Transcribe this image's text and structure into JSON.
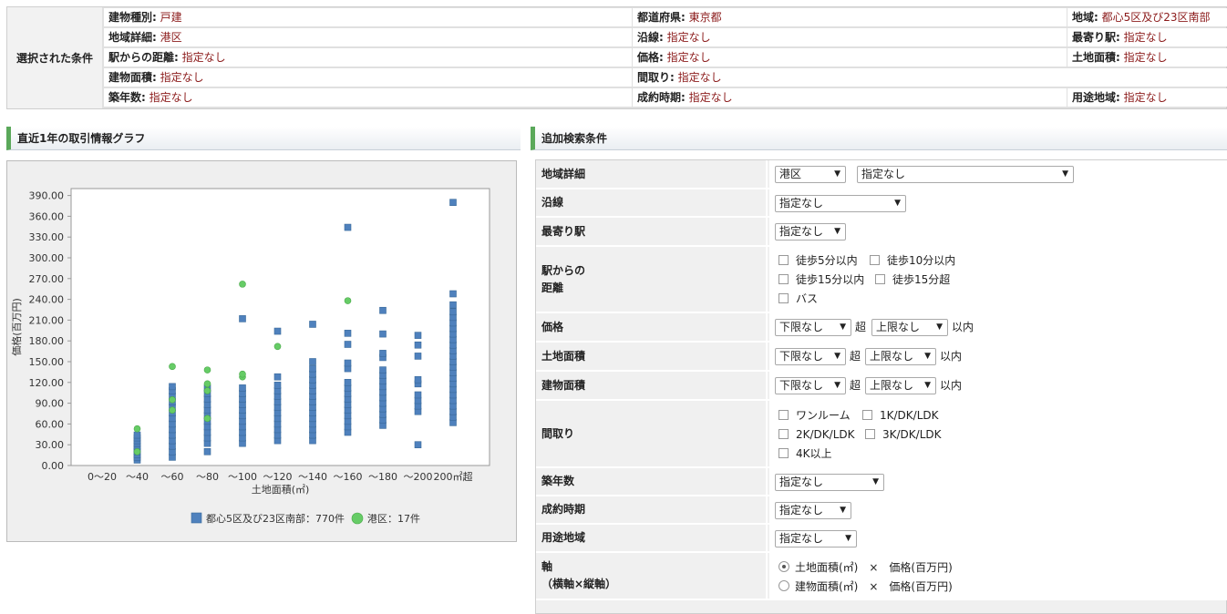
{
  "conditions": {
    "heading": "選択された条件",
    "rows": [
      [
        {
          "label": "建物種別:",
          "value": "戸建"
        },
        {
          "label": "都道府県:",
          "value": "東京都"
        },
        {
          "label": "地域:",
          "value": "都心5区及び23区南部"
        }
      ],
      [
        {
          "label": "地域詳細:",
          "value": "港区"
        },
        {
          "label": "沿線:",
          "value": "指定なし"
        },
        {
          "label": "最寄り駅:",
          "value": "指定なし"
        }
      ],
      [
        {
          "label": "駅からの距離:",
          "value": "指定なし"
        },
        {
          "label": "価格:",
          "value": "指定なし"
        },
        {
          "label": "土地面積:",
          "value": "指定なし"
        }
      ],
      [
        {
          "label": "建物面積:",
          "value": "指定なし"
        },
        {
          "label": "間取り:",
          "value": "指定なし"
        }
      ],
      [
        {
          "label": "築年数:",
          "value": "指定なし"
        },
        {
          "label": "成約時期:",
          "value": "指定なし"
        },
        {
          "label": "用途地域:",
          "value": "指定なし"
        }
      ]
    ]
  },
  "graph_section_title": "直近1年の取引情報グラフ",
  "search_section_title": "追加検索条件",
  "chart_data": {
    "type": "scatter",
    "xlabel": "土地面積(㎡)",
    "ylabel": "価格(百万円)",
    "categories": [
      "0～20",
      "～40",
      "～60",
      "～80",
      "～100",
      "～120",
      "～140",
      "～160",
      "～180",
      "～200",
      "200㎡超"
    ],
    "y_ticks": [
      "0.00",
      "30.00",
      "60.00",
      "90.00",
      "120.00",
      "150.00",
      "180.00",
      "210.00",
      "240.00",
      "270.00",
      "300.00",
      "330.00",
      "360.00",
      "390.00"
    ],
    "ylim": [
      0,
      400
    ],
    "grid": false,
    "legend_position": "bottom",
    "series": [
      {
        "name": "都心5区及び23区南部：770件",
        "marker": "square",
        "color": "#4f81bd",
        "points": [
          {
            "x": "～40",
            "y": [
              8,
              12,
              16,
              20,
              24,
              28,
              32,
              36,
              40,
              44
            ]
          },
          {
            "x": "～60",
            "y": [
              12,
              20,
              28,
              36,
              44,
              52,
              60,
              68,
              76,
              84,
              92,
              100,
              108,
              114
            ]
          },
          {
            "x": "～80",
            "y": [
              20,
              32,
              40,
              48,
              56,
              64,
              72,
              80,
              88,
              96,
              104,
              112
            ]
          },
          {
            "x": "～100",
            "y": [
              32,
              40,
              48,
              56,
              64,
              72,
              80,
              88,
              96,
              104,
              112,
              212
            ]
          },
          {
            "x": "～120",
            "y": [
              36,
              44,
              52,
              60,
              68,
              76,
              84,
              92,
              100,
              108,
              116,
              128,
              194
            ]
          },
          {
            "x": "～140",
            "y": [
              36,
              44,
              52,
              60,
              68,
              76,
              84,
              92,
              100,
              108,
              116,
              124,
              132,
              140,
              150,
              204
            ]
          },
          {
            "x": "～160",
            "y": [
              48,
              56,
              64,
              72,
              80,
              88,
              96,
              104,
              112,
              120,
              140,
              148,
              175,
              191,
              344
            ]
          },
          {
            "x": "～180",
            "y": [
              58,
              66,
              74,
              82,
              90,
              98,
              106,
              114,
              122,
              130,
              138,
              156,
              162,
              190,
              224
            ]
          },
          {
            "x": "～200",
            "y": [
              30,
              78,
              86,
              94,
              102,
              118,
              124,
              158,
              174,
              188
            ]
          },
          {
            "x": "200㎡超",
            "y": [
              62,
              70,
              78,
              86,
              94,
              102,
              110,
              118,
              126,
              134,
              142,
              150,
              158,
              166,
              174,
              182,
              190,
              198,
              206,
              214,
              222,
              232,
              248,
              380
            ]
          }
        ]
      },
      {
        "name": "港区：17件",
        "marker": "circle",
        "color": "#66cc66",
        "points": [
          {
            "x": "～40",
            "y": [
              20,
              53
            ]
          },
          {
            "x": "～60",
            "y": [
              80,
              95,
              143
            ]
          },
          {
            "x": "～80",
            "y": [
              68,
              108,
              118,
              138
            ]
          },
          {
            "x": "～100",
            "y": [
              128,
              132,
              262
            ]
          },
          {
            "x": "～120",
            "y": [
              172
            ]
          },
          {
            "x": "～160",
            "y": [
              238
            ]
          }
        ]
      }
    ]
  },
  "form": {
    "area_detail": {
      "label": "地域詳細",
      "ward": "港区",
      "sub": "指定なし"
    },
    "line": {
      "label": "沿線",
      "value": "指定なし"
    },
    "station": {
      "label": "最寄り駅",
      "value": "指定なし"
    },
    "distance": {
      "label1": "駅からの",
      "label2": "距離",
      "options": [
        "徒歩5分以内",
        "徒歩10分以内",
        "徒歩15分以内",
        "徒歩15分超",
        "バス"
      ]
    },
    "price": {
      "label": "価格",
      "min": "下限なし",
      "over": "超",
      "max": "上限なし",
      "within": "以内"
    },
    "land": {
      "label": "土地面積",
      "min": "下限なし",
      "over": "超",
      "max": "上限なし",
      "within": "以内"
    },
    "building": {
      "label": "建物面積",
      "min": "下限なし",
      "over": "超",
      "max": "上限なし",
      "within": "以内"
    },
    "layout": {
      "label": "間取り",
      "options": [
        "ワンルーム",
        "1K/DK/LDK",
        "2K/DK/LDK",
        "3K/DK/LDK",
        "4K以上"
      ]
    },
    "age": {
      "label": "築年数",
      "value": "指定なし"
    },
    "period": {
      "label": "成約時期",
      "value": "指定なし"
    },
    "zoning": {
      "label": "用途地域",
      "value": "指定なし"
    },
    "axis": {
      "label1": "軸",
      "label2": "（横軸×縦軸）",
      "options": [
        "土地面積(㎡)　×　価格(百万円)",
        "建物面積(㎡)　×　価格(百万円)"
      ]
    }
  }
}
